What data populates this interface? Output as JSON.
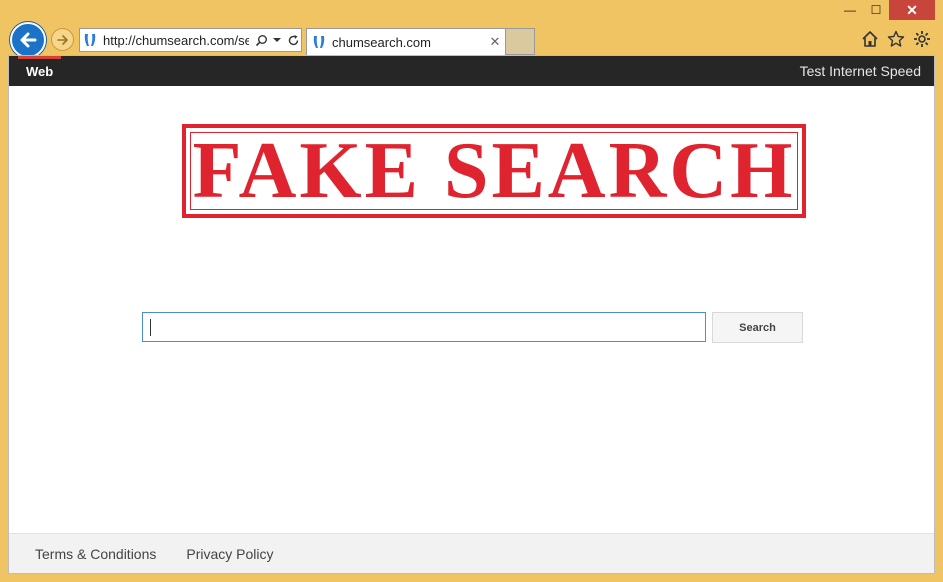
{
  "browser": {
    "address": "http://chumsearch.com/se",
    "tab_title": "chumsearch.com",
    "tab_close": "✕",
    "window": {
      "minimize": "—",
      "maximize": "☐",
      "close": "✕"
    }
  },
  "nav": {
    "web": "Web",
    "speed_test": "Test Internet Speed"
  },
  "stamp": {
    "text": "FAKE SEARCH",
    "color": "#e0242f"
  },
  "search": {
    "value": "",
    "button_label": "Search"
  },
  "footer": {
    "terms": "Terms & Conditions",
    "privacy": "Privacy Policy"
  },
  "colors": {
    "frame": "#f0c463",
    "back_button": "#1a73c6",
    "nav_bar": "#262626",
    "close_button": "#c7453b"
  }
}
